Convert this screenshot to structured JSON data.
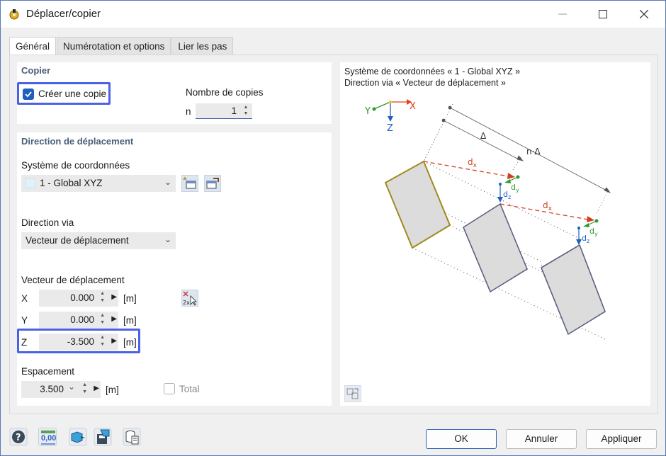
{
  "window": {
    "title": "Déplacer/copier"
  },
  "tabs": [
    {
      "label": "Général",
      "active": true
    },
    {
      "label": "Numérotation et options",
      "active": false
    },
    {
      "label": "Lier les pas",
      "active": false
    }
  ],
  "copy_section": {
    "title": "Copier",
    "create_copy_label": "Créer une copie",
    "create_copy_checked": true,
    "copies_count_label": "Nombre de copies",
    "n_label": "n",
    "n_value": "1"
  },
  "direction_section": {
    "title": "Direction de déplacement",
    "coord_system_label": "Système de coordonnées",
    "coord_system_value": "1 - Global XYZ",
    "direction_via_label": "Direction via",
    "direction_via_value": "Vecteur de déplacement",
    "vector_label": "Vecteur de déplacement",
    "x_label": "X",
    "x_value": "0.000",
    "x_unit": "[m]",
    "y_label": "Y",
    "y_value": "0.000",
    "y_unit": "[m]",
    "z_label": "Z",
    "z_value": "-3.500",
    "z_unit": "[m]",
    "spacing_label": "Espacement",
    "spacing_value": "3.500",
    "spacing_unit": "[m]",
    "total_label": "Total",
    "total_checked": false
  },
  "diagram": {
    "caption_line1": "Système de coordonnées « 1 - Global XYZ »",
    "caption_line2": "Direction via « Vecteur de déplacement »",
    "axis_x": "X",
    "axis_y": "Y",
    "axis_z": "Z",
    "delta_label": "Δ",
    "n_delta_label": "n·Δ",
    "dx_label": "dx",
    "dy_label": "dy",
    "dz_label": "dz"
  },
  "footer": {
    "ok_label": "OK",
    "cancel_label": "Annuler",
    "apply_label": "Appliquer",
    "units_icon_text": "0,00"
  },
  "colors": {
    "accent": "#4a63e6",
    "section_title": "#4a5d78",
    "axis_x": "#e0401a",
    "axis_y": "#2e9a2e",
    "axis_z": "#1f5fbf",
    "original_outline": "#a08a20",
    "copy_outline": "#5a5f80"
  }
}
